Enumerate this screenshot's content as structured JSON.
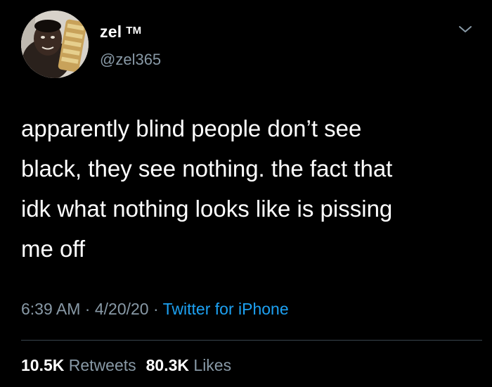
{
  "user": {
    "display_name": "zel",
    "tm_mark": "TM",
    "handle": "@zel365"
  },
  "tweet": {
    "text": "apparently blind people don’t see black, they see nothing. the fact that idk what nothing looks like is pissing me off",
    "lines": [
      "apparently blind people don’t see",
      "black, they see nothing. the fact that",
      "idk what nothing looks like is pissing",
      "me off"
    ]
  },
  "meta": {
    "time": "6:39 AM",
    "separator": "·",
    "date": "4/20/20",
    "source": "Twitter for iPhone"
  },
  "stats": {
    "retweets_count": "10.5K",
    "retweets_label": "Retweets",
    "likes_count": "80.3K",
    "likes_label": "Likes"
  },
  "icons": {
    "caret": "chevron-down-icon"
  },
  "colors": {
    "background": "#000000",
    "text_primary": "#ffffff",
    "text_secondary": "#8899a6",
    "link": "#1da1f2",
    "divider": "#38444d"
  }
}
